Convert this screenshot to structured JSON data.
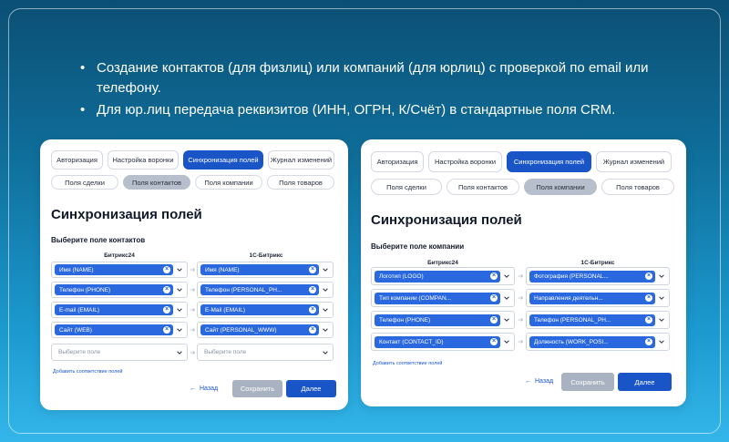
{
  "bullets": [
    "Создание контактов (для физлиц) или компаний (для юрлиц) с проверкой по email или телефону.",
    "Для юр.лиц передача реквизитов (ИНН, ОГРН, К/Счёт) в стандартные поля CRM."
  ],
  "left": {
    "tabs": [
      "Авторизация",
      "Настройка воронки",
      "Синхронизация полей",
      "Журнал изменений"
    ],
    "subtabs": [
      "Поля сделки",
      "Поля контактов",
      "Поля компании",
      "Поля товаров"
    ],
    "title": "Синхронизация полей",
    "subtitle": "Выберите поле контактов",
    "col_left": "Битрикс24",
    "col_right": "1С-Битрикс",
    "rows": [
      {
        "left": "Имя (NAME)",
        "right": "Имя (NAME)"
      },
      {
        "left": "Телефон (PHONE)",
        "right": "Телефон (PERSONAL_PH..."
      },
      {
        "left": "E-mail (EMAIL)",
        "right": "E-Mail (EMAIL)"
      },
      {
        "left": "Сайт (WEB)",
        "right": "Сайт (PERSONAL_WWW)"
      }
    ],
    "placeholder_left": "Выберите поле",
    "placeholder_right": "Выберите поле",
    "add_link": "Добавить соответствие полей",
    "back": "Назад",
    "save": "Сохранить",
    "next": "Далее"
  },
  "right": {
    "tabs": [
      "Авторизация",
      "Настройка воронки",
      "Синхронизация полей",
      "Журнал изменений"
    ],
    "subtabs": [
      "Поля сделки",
      "Поля контактов",
      "Поля компании",
      "Поля товаров"
    ],
    "title": "Синхронизация полей",
    "subtitle": "Выберите поле компании",
    "col_left": "Битрикс24",
    "col_right": "1С-Битрикс",
    "rows": [
      {
        "left": "Логотип (LOGO)",
        "right": "Фотография (PERSONAL..."
      },
      {
        "left": "Тип компании (COMPAN...",
        "right": "Направления деятельн..."
      },
      {
        "left": "Телефон (PHONE)",
        "right": "Телефон (PERSONAL_PH..."
      },
      {
        "left": "Контакт (CONTACT_ID)",
        "right": "Должность (WORK_POSI..."
      }
    ],
    "add_link": "Добавить соответствие полей",
    "back": "Назад",
    "save": "Сохранить",
    "next": "Далее"
  },
  "colors": {
    "accent": "#1a55c8",
    "chip": "#2a68e0",
    "disabled": "#a9b2c0",
    "bg_top": "#0b4f74",
    "bg_bottom": "#34b6ea"
  }
}
